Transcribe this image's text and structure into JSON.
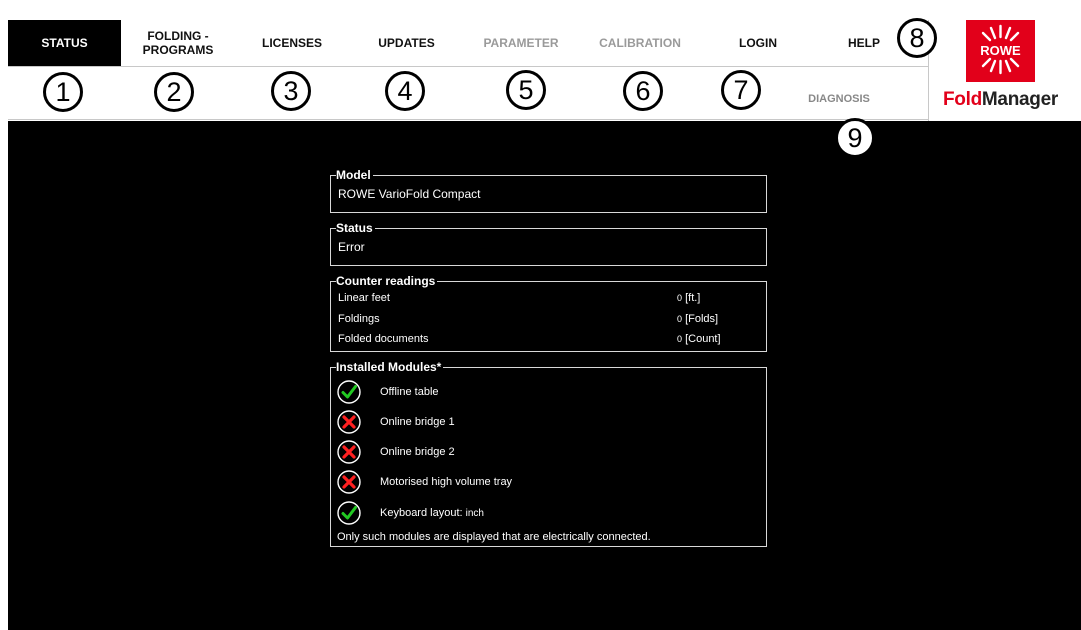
{
  "nav": {
    "tabs": [
      {
        "label": "STATUS"
      },
      {
        "label": "FOLDING -\nPROGRAMS"
      },
      {
        "label": "LICENSES"
      },
      {
        "label": "UPDATES"
      },
      {
        "label": "PARAMETER"
      },
      {
        "label": "CALIBRATION"
      },
      {
        "label": "LOGIN"
      },
      {
        "label": "HELP"
      }
    ],
    "diagnosis": "DIAGNOSIS"
  },
  "markers": [
    "1",
    "2",
    "3",
    "4",
    "5",
    "6",
    "7",
    "8",
    "9"
  ],
  "logo": {
    "brand": "ROWE",
    "fold": "Fold",
    "manager": "Manager",
    "color": "#e2001a"
  },
  "model": {
    "title": "Model",
    "value": "ROWE VarioFold Compact"
  },
  "status": {
    "title": "Status",
    "value": "Error"
  },
  "counters": {
    "title": "Counter readings",
    "rows": [
      {
        "label": "Linear feet",
        "num": "0",
        "unit": "[ft.]"
      },
      {
        "label": "Foldings",
        "num": "0",
        "unit": "[Folds]"
      },
      {
        "label": "Folded documents",
        "num": "0",
        "unit": "[Count]"
      }
    ]
  },
  "modules": {
    "title": "Installed Modules*",
    "items": [
      {
        "label": "Offline table",
        "state": "ok"
      },
      {
        "label": "Online bridge 1",
        "state": "error"
      },
      {
        "label": "Online bridge 2",
        "state": "error"
      },
      {
        "label": "Motorised high volume tray",
        "state": "error"
      },
      {
        "label": "Keyboard layout:",
        "extra": "inch",
        "state": "ok"
      }
    ],
    "note": "Only such modules are displayed that are electrically connected."
  },
  "colors": {
    "ok": "#22c922",
    "error": "#ff2020",
    "active_tab": "#000000"
  }
}
